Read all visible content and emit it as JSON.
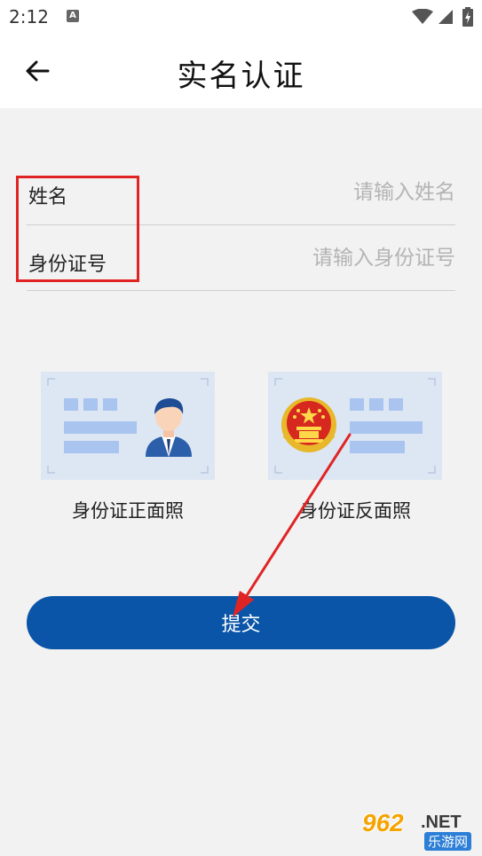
{
  "status_bar": {
    "time": "2:12",
    "notification_icon": "A"
  },
  "header": {
    "title": "实名认证"
  },
  "form": {
    "name_label": "姓名",
    "name_placeholder": "请输入姓名",
    "id_label": "身份证号",
    "id_placeholder": "请输入身份证号"
  },
  "id_photos": {
    "front_caption": "身份证正面照",
    "back_caption": "身份证反面照"
  },
  "submit_label": "提交",
  "watermark": {
    "number": "962",
    "net": ".NET",
    "site": "乐游网"
  },
  "colors": {
    "primary": "#0a55a8",
    "annotation": "#e02424",
    "card_bg": "#dde6f3",
    "card_block": "#a9c4ee"
  },
  "icons": [
    "back-arrow-icon",
    "wifi-icon",
    "signal-icon",
    "battery-icon",
    "person-avatar-icon",
    "national-emblem-icon"
  ]
}
